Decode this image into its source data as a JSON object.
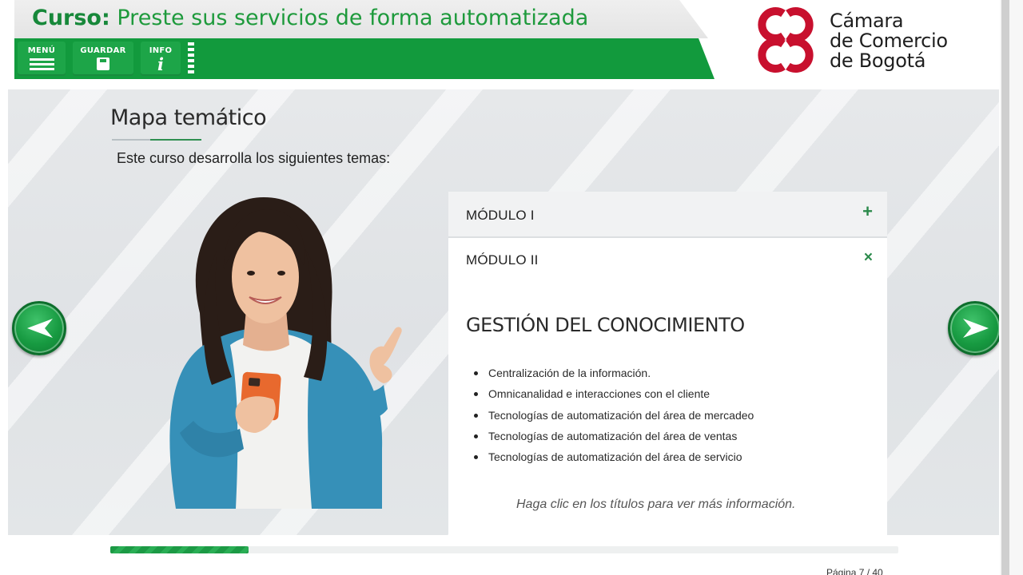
{
  "header": {
    "course_prefix": "Curso:",
    "course_name": "Preste sus servicios de forma automatizada",
    "buttons": {
      "menu_label": "MENÚ",
      "save_label": "GUARDAR",
      "info_label": "INFO",
      "info_glyph": "i"
    },
    "logo": {
      "line1": "Cámara",
      "line2": "de Comercio",
      "line3": "de Bogotá",
      "color": "#c8102e"
    }
  },
  "main": {
    "title": "Mapa temático",
    "intro": "Este curso desarrolla los siguientes temas:",
    "accordion": [
      {
        "label": "MÓDULO I",
        "icon": "plus-icon",
        "glyph": "+",
        "expanded": false
      },
      {
        "label": "MÓDULO II",
        "icon": "close-icon",
        "glyph": "×",
        "expanded": true,
        "heading": "GESTIÓN DEL CONOCIMIENTO",
        "items": [
          "Centralización de la información.",
          "Omnicanalidad e interacciones con el cliente",
          "Tecnologías de automatización del área de mercadeo",
          "Tecnologías de automatización del área de ventas",
          "Tecnologías de automatización del área de servicio"
        ]
      }
    ],
    "hint": "Haga clic en los títulos para ver más información."
  },
  "navigation": {
    "prev_icon": "arrow-left-icon",
    "next_icon": "arrow-right-icon"
  },
  "footer": {
    "progress_fraction": 0.175,
    "page_label": "Página 7 / 40"
  },
  "colors": {
    "brand_green": "#129a3d",
    "accent_green": "#2b8a4b",
    "logo_red": "#c8102e"
  }
}
